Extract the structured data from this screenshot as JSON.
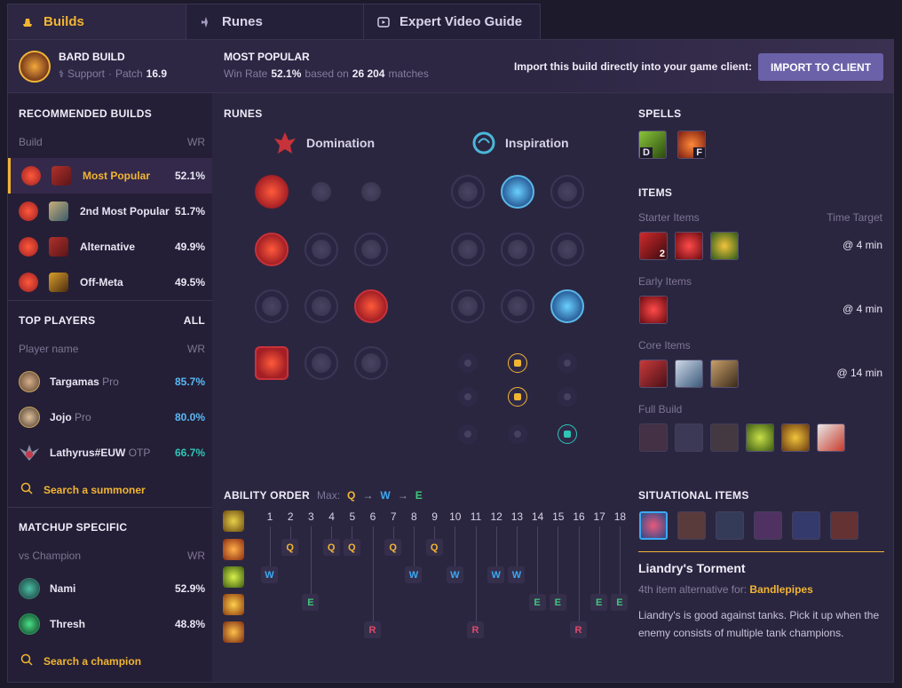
{
  "tabs": [
    {
      "label": "Builds",
      "icon": "hat-icon"
    },
    {
      "label": "Runes",
      "icon": "runes-icon"
    },
    {
      "label": "Expert Video Guide",
      "icon": "video-icon"
    }
  ],
  "header": {
    "build_title": "BARD BUILD",
    "role": "Support",
    "patch_label": "Patch",
    "patch": "16.9",
    "most_popular_title": "MOST POPULAR",
    "win_rate_label": "Win Rate",
    "win_rate": "52.1%",
    "based_on": "based on",
    "matches": "26 204",
    "matches_label": "matches",
    "import_prompt": "Import this build directly into your game client:",
    "import_button": "IMPORT TO CLIENT"
  },
  "recommended": {
    "title": "RECOMMENDED BUILDS",
    "col_build": "Build",
    "col_wr": "WR",
    "items": [
      {
        "label": "Most Popular",
        "wr": "52.1%"
      },
      {
        "label": "2nd Most Popular",
        "wr": "51.7%"
      },
      {
        "label": "Alternative",
        "wr": "49.9%"
      },
      {
        "label": "Off-Meta",
        "wr": "49.5%"
      }
    ]
  },
  "top_players": {
    "title": "TOP PLAYERS",
    "all": "ALL",
    "col_name": "Player name",
    "col_wr": "WR",
    "players": [
      {
        "name": "Targamas",
        "tag": "Pro",
        "wr": "85.7%",
        "color": "#5ab8f5"
      },
      {
        "name": "Jojo",
        "tag": "Pro",
        "wr": "80.0%",
        "color": "#5ab8f5"
      },
      {
        "name": "Lathyrus#EUW",
        "tag": "OTP",
        "wr": "66.7%",
        "color": "#2ec4b6"
      }
    ],
    "search": "Search a summoner"
  },
  "matchup": {
    "title": "MATCHUP SPECIFIC",
    "col_vs": "vs Champion",
    "col_wr": "WR",
    "items": [
      {
        "name": "Nami",
        "wr": "52.9%"
      },
      {
        "name": "Thresh",
        "wr": "48.8%"
      }
    ],
    "search": "Search a champion"
  },
  "runes": {
    "title": "RUNES",
    "primary": "Domination",
    "secondary": "Inspiration"
  },
  "spells": {
    "title": "SPELLS",
    "keys": [
      "D",
      "F"
    ]
  },
  "items": {
    "title": "ITEMS",
    "starter": "Starter Items",
    "time_target": "Time Target",
    "starter_time": "@ 4 min",
    "starter_count": "2",
    "early": "Early Items",
    "early_time": "@ 4 min",
    "core": "Core Items",
    "core_time": "@ 14 min",
    "full": "Full Build"
  },
  "ability": {
    "title": "ABILITY ORDER",
    "max_label": "Max:",
    "max": [
      "Q",
      "W",
      "E"
    ],
    "levels": [
      "1",
      "2",
      "3",
      "4",
      "5",
      "6",
      "7",
      "8",
      "9",
      "10",
      "11",
      "12",
      "13",
      "14",
      "15",
      "16",
      "17",
      "18"
    ],
    "rows": {
      "q": [
        2,
        4,
        5,
        7,
        9
      ],
      "w": [
        1,
        8,
        10,
        12,
        13
      ],
      "e": [
        3,
        14,
        15,
        17,
        18
      ],
      "r": [
        6,
        11,
        16
      ]
    }
  },
  "situational": {
    "title": "SITUATIONAL ITEMS",
    "item_name": "Liandry's Torment",
    "alt_prefix": "4th item alternative for:",
    "alt_item": "Bandlepipes",
    "description": "Liandry's is good against tanks. Pick it up when the enemy consists of multiple tank champions."
  }
}
